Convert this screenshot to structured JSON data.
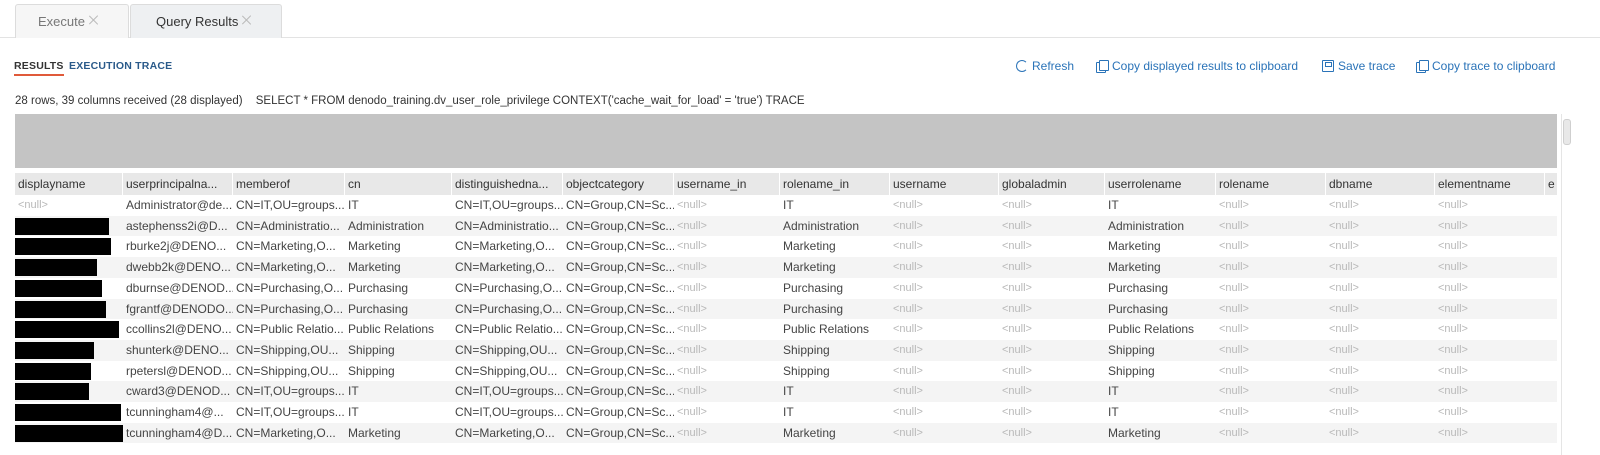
{
  "tabs": [
    {
      "label": "Execute",
      "active": false
    },
    {
      "label": "Query Results",
      "active": true
    }
  ],
  "subtabs": [
    {
      "label": "RESULTS",
      "active": true
    },
    {
      "label": "EXECUTION TRACE",
      "active": false
    }
  ],
  "actions": {
    "refresh": "Refresh",
    "copy_results": "Copy displayed results to clipboard",
    "save_trace": "Save trace",
    "copy_trace": "Copy trace to clipboard"
  },
  "status": {
    "summary": "28 rows, 39 columns received (28 displayed)",
    "query": "SELECT * FROM denodo_training.dv_user_role_privilege CONTEXT('cache_wait_for_load' = 'true') TRACE"
  },
  "table": {
    "columns": [
      "displayname",
      "userprincipalna...",
      "memberof",
      "cn",
      "distinguishedna...",
      "objectcategory",
      "username_in",
      "rolename_in",
      "username",
      "globaladmin",
      "userrolename",
      "rolename",
      "dbname",
      "elementname",
      "e"
    ],
    "rows": [
      [
        "<null>",
        "Administrator@de...",
        "CN=IT,OU=groups...",
        "IT",
        "CN=IT,OU=groups...",
        "CN=Group,CN=Sc...",
        "<null>",
        "IT",
        "<null>",
        "<null>",
        "IT",
        "<null>",
        "<null>",
        "<null>",
        ""
      ],
      [
        "",
        "astephenss2i@D...",
        "CN=Administratio...",
        "Administration",
        "CN=Administratio...",
        "CN=Group,CN=Sc...",
        "<null>",
        "Administration",
        "<null>",
        "<null>",
        "Administration",
        "<null>",
        "<null>",
        "<null>",
        ""
      ],
      [
        "",
        "rburke2j@DENO...",
        "CN=Marketing,O...",
        "Marketing",
        "CN=Marketing,O...",
        "CN=Group,CN=Sc...",
        "<null>",
        "Marketing",
        "<null>",
        "<null>",
        "Marketing",
        "<null>",
        "<null>",
        "<null>",
        ""
      ],
      [
        "",
        "dwebb2k@DENO...",
        "CN=Marketing,O...",
        "Marketing",
        "CN=Marketing,O...",
        "CN=Group,CN=Sc...",
        "<null>",
        "Marketing",
        "<null>",
        "<null>",
        "Marketing",
        "<null>",
        "<null>",
        "<null>",
        ""
      ],
      [
        "",
        "dburnse@DENOD...",
        "CN=Purchasing,O...",
        "Purchasing",
        "CN=Purchasing,O...",
        "CN=Group,CN=Sc...",
        "<null>",
        "Purchasing",
        "<null>",
        "<null>",
        "Purchasing",
        "<null>",
        "<null>",
        "<null>",
        ""
      ],
      [
        "",
        "fgrantf@DENODO...",
        "CN=Purchasing,O...",
        "Purchasing",
        "CN=Purchasing,O...",
        "CN=Group,CN=Sc...",
        "<null>",
        "Purchasing",
        "<null>",
        "<null>",
        "Purchasing",
        "<null>",
        "<null>",
        "<null>",
        ""
      ],
      [
        "",
        "ccollins2l@DENO...",
        "CN=Public Relatio...",
        "Public Relations",
        "CN=Public Relatio...",
        "CN=Group,CN=Sc...",
        "<null>",
        "Public Relations",
        "<null>",
        "<null>",
        "Public Relations",
        "<null>",
        "<null>",
        "<null>",
        ""
      ],
      [
        "",
        "shunterk@DENO...",
        "CN=Shipping,OU...",
        "Shipping",
        "CN=Shipping,OU...",
        "CN=Group,CN=Sc...",
        "<null>",
        "Shipping",
        "<null>",
        "<null>",
        "Shipping",
        "<null>",
        "<null>",
        "<null>",
        ""
      ],
      [
        "",
        "rpetersl@DENOD...",
        "CN=Shipping,OU...",
        "Shipping",
        "CN=Shipping,OU...",
        "CN=Group,CN=Sc...",
        "<null>",
        "Shipping",
        "<null>",
        "<null>",
        "Shipping",
        "<null>",
        "<null>",
        "<null>",
        ""
      ],
      [
        "",
        "cward3@DENOD...",
        "CN=IT,OU=groups...",
        "IT",
        "CN=IT,OU=groups...",
        "CN=Group,CN=Sc...",
        "<null>",
        "IT",
        "<null>",
        "<null>",
        "IT",
        "<null>",
        "<null>",
        "<null>",
        ""
      ],
      [
        "",
        "tcunningham4@...",
        "CN=IT,OU=groups...",
        "IT",
        "CN=IT,OU=groups...",
        "CN=Group,CN=Sc...",
        "<null>",
        "IT",
        "<null>",
        "<null>",
        "IT",
        "<null>",
        "<null>",
        "<null>",
        ""
      ],
      [
        "",
        "tcunningham4@D...",
        "CN=Marketing,O...",
        "Marketing",
        "CN=Marketing,O...",
        "CN=Group,CN=Sc...",
        "<null>",
        "Marketing",
        "<null>",
        "<null>",
        "Marketing",
        "<null>",
        "<null>",
        "<null>",
        ""
      ]
    ],
    "redacted_rows": [
      1,
      2,
      3,
      4,
      5,
      6,
      7,
      8,
      9,
      10,
      11
    ]
  }
}
